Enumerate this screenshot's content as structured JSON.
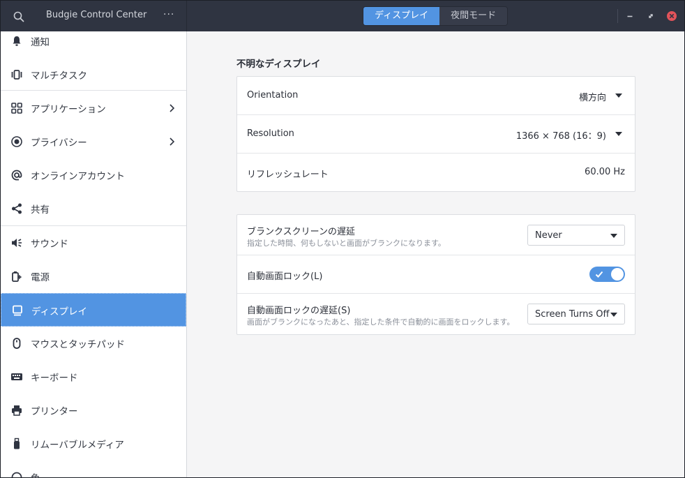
{
  "header": {
    "app_title": "Budgie Control Center",
    "menu_glyph": "···",
    "tabs": [
      {
        "label": "ディスプレイ",
        "active": true
      },
      {
        "label": "夜間モード",
        "active": false
      }
    ],
    "window_controls": [
      "minimize-icon",
      "restore-icon",
      "close-icon"
    ],
    "colors": {
      "accent": "#5294e2",
      "close": "#e2535a",
      "headerbar": "#2f3441"
    }
  },
  "sidebar": {
    "items": [
      {
        "label": "通知",
        "icon": "bell-icon"
      },
      {
        "label": "マルチタスク",
        "icon": "multitasking-icon"
      },
      {
        "label": "アプリケーション",
        "icon": "applications-grid-icon",
        "has_submenu": true
      },
      {
        "label": "プライバシー",
        "icon": "privacy-icon",
        "has_submenu": true
      },
      {
        "label": "オンラインアカウント",
        "icon": "at-sign-icon"
      },
      {
        "label": "共有",
        "icon": "share-icon"
      },
      {
        "label": "サウンド",
        "icon": "speaker-icon"
      },
      {
        "label": "電源",
        "icon": "power-plug-icon"
      },
      {
        "label": "ディスプレイ",
        "icon": "display-icon",
        "selected": true
      },
      {
        "label": "マウスとタッチパッド",
        "icon": "mouse-icon"
      },
      {
        "label": "キーボード",
        "icon": "keyboard-icon"
      },
      {
        "label": "プリンター",
        "icon": "printer-icon"
      },
      {
        "label": "リムーバブルメディア",
        "icon": "usb-drive-icon"
      },
      {
        "label": "色",
        "icon": "color-icon"
      }
    ]
  },
  "display": {
    "section_title": "不明なディスプレイ",
    "orientation": {
      "label": "Orientation",
      "value": "横方向"
    },
    "resolution": {
      "label": "Resolution",
      "value": "1366 × 768 (16：9)"
    },
    "refresh_rate": {
      "label": "リフレッシュレート",
      "value": "60.00 Hz"
    }
  },
  "screen_lock": {
    "blank_delay": {
      "label": "ブランクスクリーンの遅延",
      "description": "指定した時間、何もしないと画面がブランクになります。",
      "value": "Never"
    },
    "auto_lock": {
      "label": "自動画面ロック(L)",
      "enabled": true
    },
    "lock_delay": {
      "label": "自動画面ロックの遅延(S)",
      "description": "画面がブランクになったあと、指定した条件で自動的に画面をロックします。",
      "value": "Screen Turns Off"
    }
  }
}
